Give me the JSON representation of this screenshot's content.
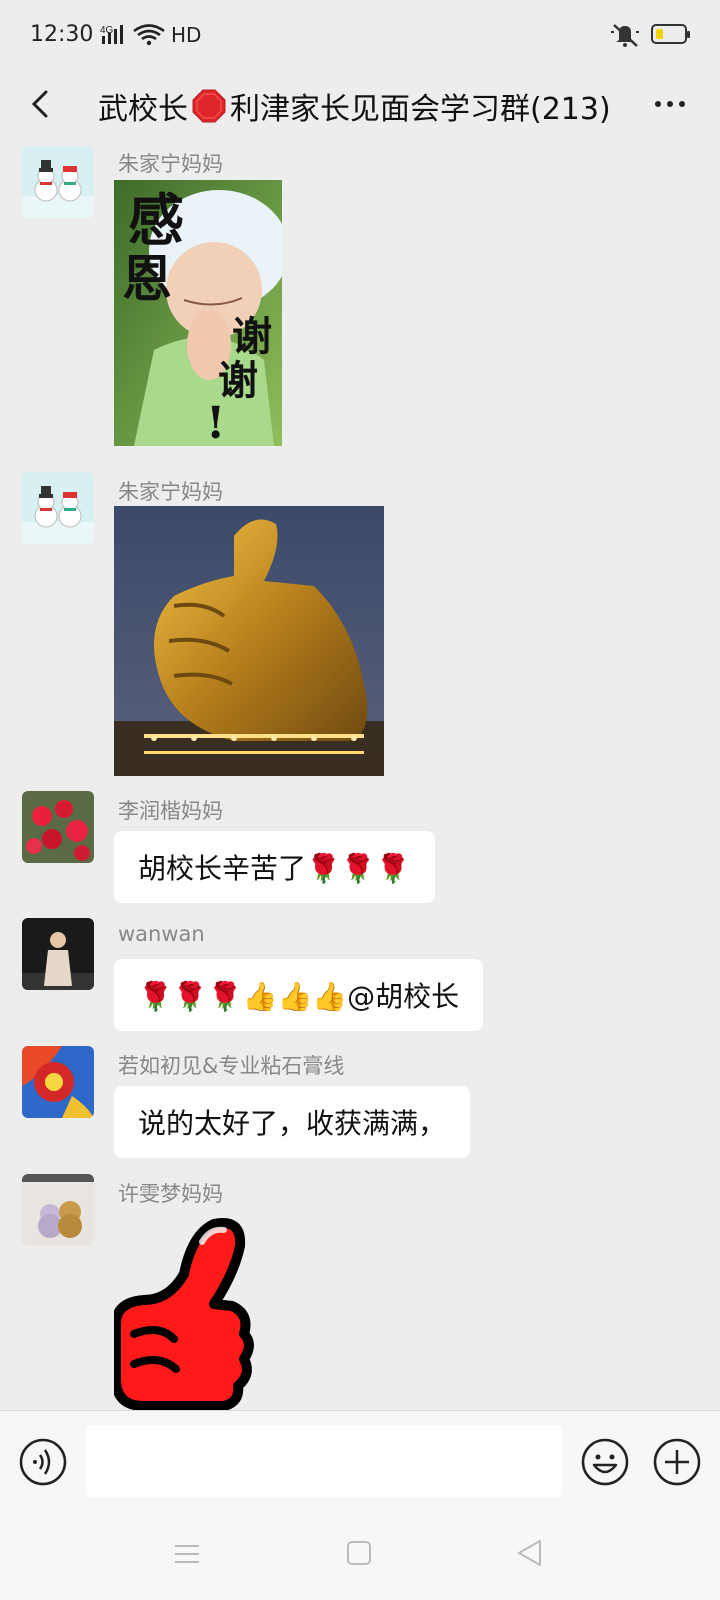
{
  "status_bar": {
    "time": "12:30",
    "network": "4G",
    "hd": "HD",
    "battery_level": 0.2
  },
  "header": {
    "title_part1": "武校长",
    "title_part2": "利津家长见面会学习群(213)",
    "badge_icon": "stop-sign-icon"
  },
  "messages": [
    {
      "sender": "朱家宁妈妈",
      "type": "image",
      "image_text": {
        "line1": "感",
        "line2": "恩",
        "line3": "谢",
        "line4": "谢",
        "line5": "!"
      }
    },
    {
      "sender": "朱家宁妈妈",
      "type": "image",
      "image_desc_icon": "golden-thumbs-up-statue"
    },
    {
      "sender": "李润楷妈妈",
      "type": "text",
      "text": "胡校长辛苦了🌹🌹🌹"
    },
    {
      "sender": "wanwan",
      "type": "text",
      "text": "🌹🌹🌹👍👍👍@胡校长"
    },
    {
      "sender": "若如初见&专业粘石膏线",
      "type": "text",
      "text": "说的太好了，收获满满，"
    },
    {
      "sender": "许雯梦妈妈",
      "type": "image",
      "image_desc_icon": "red-thumbs-up-sticker"
    }
  ],
  "input": {
    "placeholder": "",
    "value": ""
  },
  "colors": {
    "background": "#ededed",
    "bubble": "#ffffff",
    "sender": "#888888"
  }
}
